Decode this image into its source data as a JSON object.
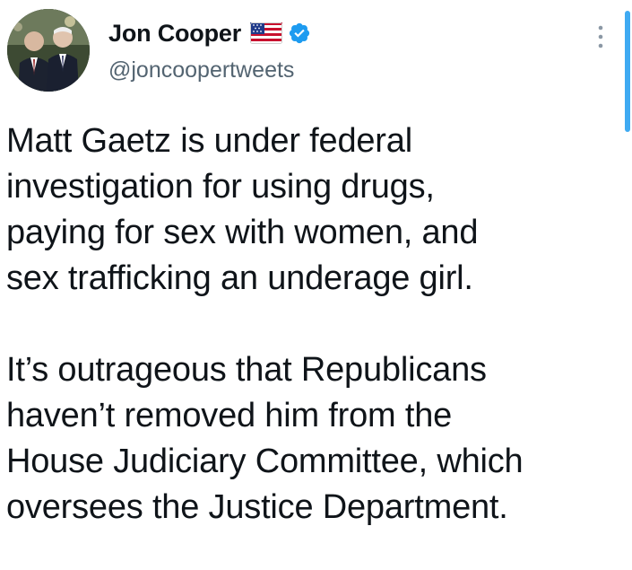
{
  "author": {
    "display_name": "Jon Cooper",
    "handle": "@joncoopertweets",
    "flag_emoji": "us-flag-icon",
    "verified": true,
    "verified_color": "#1d9bf0"
  },
  "tweet": {
    "paragraphs": [
      "Matt Gaetz is under federal\ninvestigation for using drugs,\npaying for sex with women, and\nsex trafficking an underage girl.",
      "It’s outrageous that Republicans\nhaven’t removed him from the\nHouse Judiciary Committee, which\noversees the Justice Department."
    ]
  },
  "colors": {
    "text": "#0f1419",
    "secondary": "#536471",
    "accent": "#1d9bf0"
  },
  "icons": {
    "more": "more-vertical-icon",
    "verified": "verified-badge-icon",
    "flag": "us-flag-icon"
  }
}
